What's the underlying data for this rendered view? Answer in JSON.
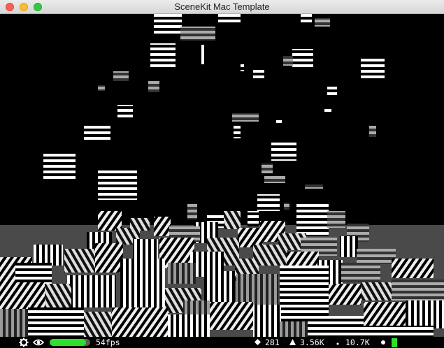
{
  "window": {
    "title": "SceneKit Mac Template",
    "controls": [
      "close-button",
      "minimize-button",
      "zoom-button"
    ]
  },
  "stats": {
    "fps_label": "54fps",
    "fps_fraction": 0.9,
    "nodes": "281",
    "triangles": "3.56K",
    "vertices": "10.7K",
    "icons": {
      "settings": "gear-icon",
      "visibility": "eye-icon",
      "nodes": "diamond-icon",
      "triangles": "triangle-icon",
      "vertices": "dot-icon"
    },
    "colors": {
      "fps_bar": "#2ee02e",
      "gpu_indicator": "#2ee02e",
      "background": "#000000"
    }
  }
}
